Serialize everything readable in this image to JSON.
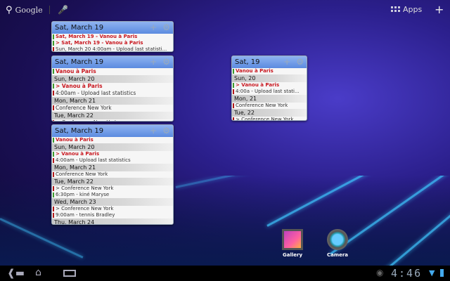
{
  "topbar": {
    "search_label": "Google",
    "apps_label": "Apps"
  },
  "widgets": [
    {
      "title": "Sat, March 19",
      "rows": [
        {
          "type": "event",
          "text": "Sat, March 19 - Vanou à Paris",
          "color": "#3a9a2a",
          "highlight": true
        },
        {
          "type": "event",
          "text": "> Sat, March 19 - Vanou à Paris",
          "color": "#3a9a2a",
          "highlight": true
        },
        {
          "type": "event",
          "text": "Sun, March 20 4:00am - Upload last statisti...",
          "color": "#b01818",
          "highlight": false
        }
      ]
    },
    {
      "title": "Sat, March 19",
      "rows": [
        {
          "type": "event",
          "text": "Vanou à Paris",
          "color": "#3a9a2a",
          "highlight": true
        },
        {
          "type": "day",
          "text": "Sun, March 20"
        },
        {
          "type": "event",
          "text": "> Vanou à Paris",
          "color": "#3a9a2a",
          "highlight": true
        },
        {
          "type": "event",
          "text": "4:00am - Upload last statistics",
          "color": "#b01818",
          "highlight": false
        },
        {
          "type": "day",
          "text": "Mon, March 21"
        },
        {
          "type": "event",
          "text": "Conference New York",
          "color": "#b01818",
          "highlight": false
        },
        {
          "type": "day",
          "text": "Tue, March 22"
        },
        {
          "type": "event",
          "text": "> Conference New York",
          "color": "#b01818",
          "highlight": false
        }
      ]
    },
    {
      "title": "Sat, March 19",
      "rows": [
        {
          "type": "event",
          "text": "Vanou à Paris",
          "color": "#3a9a2a",
          "highlight": true
        },
        {
          "type": "day",
          "text": "Sun, March 20"
        },
        {
          "type": "event",
          "text": "> Vanou à Paris",
          "color": "#3a9a2a",
          "highlight": true
        },
        {
          "type": "event",
          "text": "4:00am - Upload last statistics",
          "color": "#b01818",
          "highlight": false
        },
        {
          "type": "day",
          "text": "Mon, March 21"
        },
        {
          "type": "event",
          "text": "Conference New York",
          "color": "#b01818",
          "highlight": false
        },
        {
          "type": "day",
          "text": "Tue, March 22"
        },
        {
          "type": "event",
          "text": "> Conference New York",
          "color": "#b01818",
          "highlight": false
        },
        {
          "type": "event",
          "text": "6:30pm - kiné Maryse",
          "color": "#3a9a2a",
          "highlight": false
        },
        {
          "type": "day",
          "text": "Wed, March 23"
        },
        {
          "type": "event",
          "text": "> Conference New York",
          "color": "#b01818",
          "highlight": false
        },
        {
          "type": "event",
          "text": "9:00am - tennis Bradley",
          "color": "#b01818",
          "highlight": false
        },
        {
          "type": "day",
          "text": "Thu, March 24"
        }
      ]
    },
    {
      "title": "Sat, 19",
      "rows": [
        {
          "type": "event",
          "text": "Vanou à Paris",
          "color": "#3a9a2a",
          "highlight": true
        },
        {
          "type": "day",
          "text": "Sun, 20"
        },
        {
          "type": "event",
          "text": "> Vanou à Paris",
          "color": "#3a9a2a",
          "highlight": true
        },
        {
          "type": "event",
          "text": "4:00a - Upload last stati...",
          "color": "#b01818",
          "highlight": false
        },
        {
          "type": "day",
          "text": "Mon, 21"
        },
        {
          "type": "event",
          "text": "Conference New York",
          "color": "#b01818",
          "highlight": false
        },
        {
          "type": "day",
          "text": "Tue, 22"
        },
        {
          "type": "event",
          "text": "> Conference New York",
          "color": "#b01818",
          "highlight": false
        }
      ]
    }
  ],
  "shortcuts": [
    {
      "label": "Gallery"
    },
    {
      "label": "Camera"
    }
  ],
  "status": {
    "time": "4:46"
  }
}
